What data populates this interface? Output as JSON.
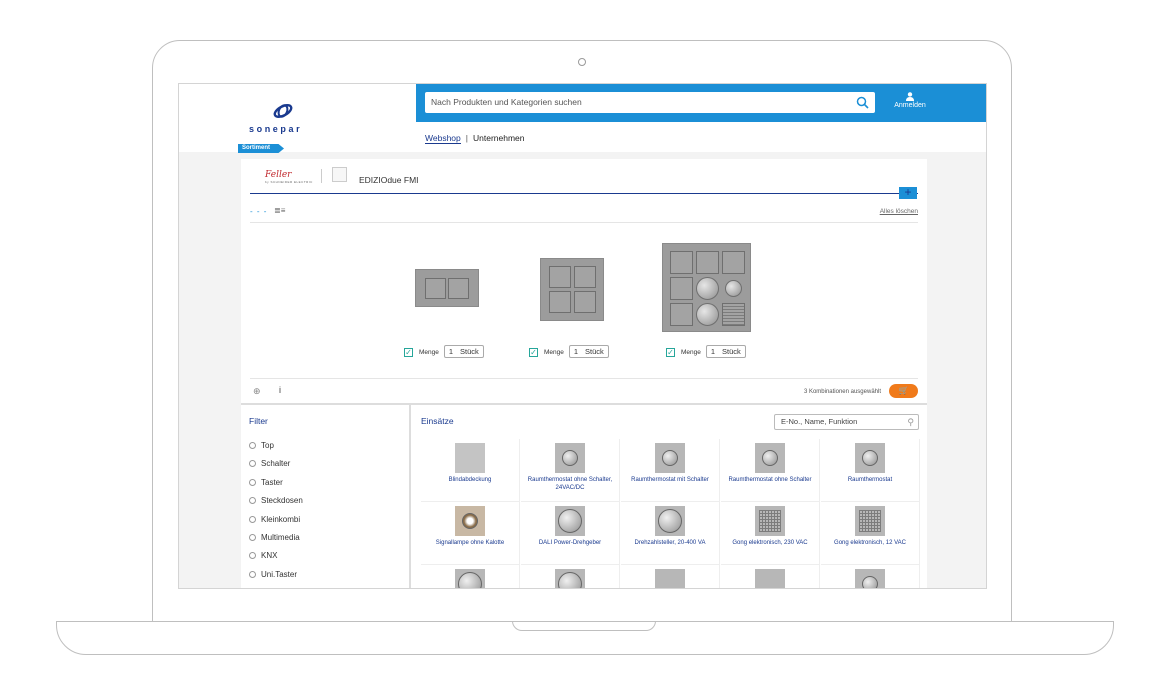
{
  "header": {
    "logo_text": "sonepar",
    "sortiment_label": "Sortiment",
    "search_placeholder": "Nach Produkten und Kategorien suchen",
    "login_label": "Anmelden",
    "nav": {
      "webshop": "Webshop",
      "separator": "|",
      "company": "Unternehmen"
    }
  },
  "configurator": {
    "brand_logo": "Feller",
    "brand_sub": "by SCHNEIDER ELECTRIC",
    "series": "EDIZIOdue FMI",
    "plus": "+",
    "view_grid": "- - -",
    "view_list": "≣≡",
    "clear_all": "Alles löschen",
    "products": [
      {
        "menge_label": "Menge",
        "qty": "1",
        "unit": "Stück",
        "checked": true
      },
      {
        "menge_label": "Menge",
        "qty": "1",
        "unit": "Stück",
        "checked": true
      },
      {
        "menge_label": "Menge",
        "qty": "1",
        "unit": "Stück",
        "checked": true
      }
    ],
    "info_icon": "i",
    "combinations_text": "3 Kombinationen ausgewählt"
  },
  "filter": {
    "title": "Filter",
    "items": [
      "Top",
      "Schalter",
      "Taster",
      "Steckdosen",
      "Kleinkombi",
      "Multimedia",
      "KNX",
      "Uni.Taster"
    ]
  },
  "inserts": {
    "title": "Einsätze",
    "search_placeholder": "E-No., Name, Funktion",
    "cells": [
      "Blindabdeckung",
      "Raumthermostat ohne Schalter, 24VAC/DC",
      "Raumthermostat mit Schalter",
      "Raumthermostat ohne Schalter",
      "Raumthermostat",
      "Signallampe ohne Kalotte",
      "DALI Power-Drehgeber",
      "Drehzahlsteller, 20-400 VA",
      "Gong elektronisch, 230 VAC",
      "Gong elektronisch, 12 VAC"
    ]
  },
  "colors": {
    "brand_blue": "#1b8fd6",
    "navy": "#1a3a8f",
    "cart_orange": "#f07a1a"
  }
}
